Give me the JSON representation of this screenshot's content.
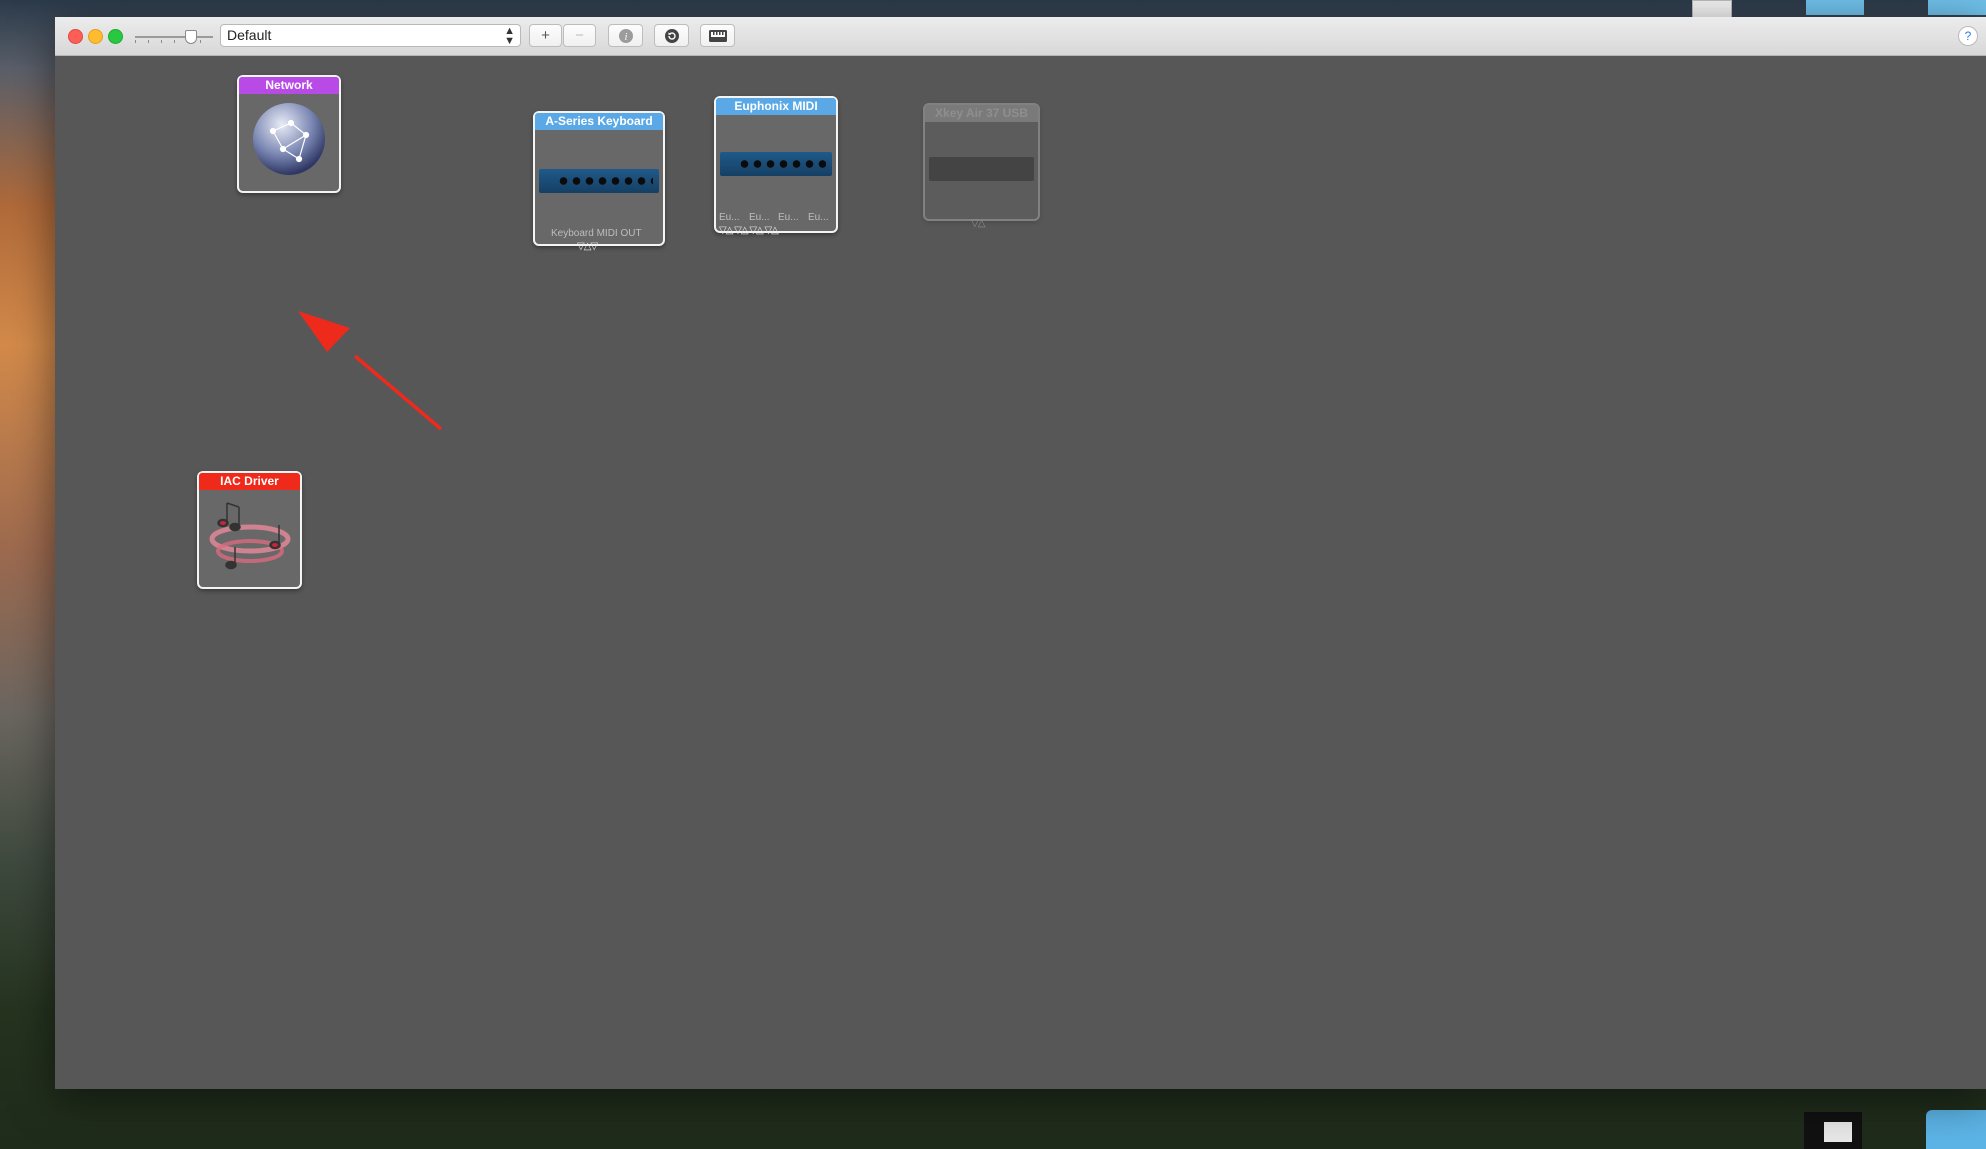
{
  "window": {
    "config_select": {
      "value": "Default"
    },
    "toolbar": {
      "add_label": "+",
      "remove_label": "−",
      "info_icon": "info-icon",
      "rescan_icon": "rescan-icon",
      "keyboard_icon": "keyboard-icon",
      "help_label": "?"
    }
  },
  "devices": {
    "network": {
      "title": "Network",
      "color": "#b84ae6"
    },
    "a_series": {
      "title": "A-Series Keyboard",
      "port_label": "Keyboard MIDI OUT",
      "color": "#5aa9e6"
    },
    "euphonix": {
      "title": "Euphonix MIDI",
      "port_labels": [
        "Eu...",
        "Eu...",
        "Eu...",
        "Eu..."
      ],
      "color": "#5aa9e6"
    },
    "xkey": {
      "title": "Xkey Air 37 USB",
      "status": "offline"
    },
    "iac": {
      "title": "IAC Driver",
      "color": "#f02a1a"
    }
  },
  "annotation": {
    "color": "#ee2a1d"
  }
}
